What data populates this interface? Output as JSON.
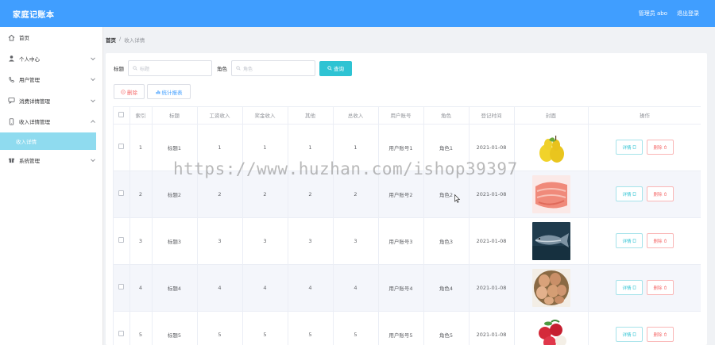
{
  "header": {
    "app_title": "家庭记账本",
    "admin_label": "管理员 abo",
    "logout_label": "退出登录"
  },
  "sidebar": {
    "items": [
      {
        "label": "首页",
        "icon": "home-icon"
      },
      {
        "label": "个人中心",
        "icon": "user-icon"
      },
      {
        "label": "用户管理",
        "icon": "phone-icon"
      },
      {
        "label": "消费详情管理",
        "icon": "chat-icon"
      },
      {
        "label": "收入详情管理",
        "icon": "mobile-icon"
      },
      {
        "label": "系统管理",
        "icon": "gift-icon"
      }
    ],
    "sub_item": {
      "label": "收入详情"
    }
  },
  "breadcrumb": {
    "home": "首页",
    "separator": "/",
    "current": "收入详情"
  },
  "search": {
    "title_label": "标题",
    "title_placeholder": "标题",
    "role_label": "角色",
    "role_placeholder": "角色",
    "query_label": "查询"
  },
  "actions": {
    "delete_label": "删除",
    "stats_label": "统计报表"
  },
  "table": {
    "headers": [
      "索引",
      "标题",
      "工资收入",
      "奖金收入",
      "其他",
      "总收入",
      "用户账号",
      "角色",
      "登记时间",
      "封面",
      "操作"
    ],
    "rows": [
      {
        "index": "1",
        "title": "标题1",
        "salary": "1",
        "bonus": "1",
        "other": "1",
        "total": "1",
        "account": "用户账号1",
        "role": "角色1",
        "date": "2021-01-08",
        "cover": "pear"
      },
      {
        "index": "2",
        "title": "标题2",
        "salary": "2",
        "bonus": "2",
        "other": "2",
        "total": "2",
        "account": "用户账号2",
        "role": "角色2",
        "date": "2021-01-08",
        "cover": "meat"
      },
      {
        "index": "3",
        "title": "标题3",
        "salary": "3",
        "bonus": "3",
        "other": "3",
        "total": "3",
        "account": "用户账号3",
        "role": "角色3",
        "date": "2021-01-08",
        "cover": "fish"
      },
      {
        "index": "4",
        "title": "标题4",
        "salary": "4",
        "bonus": "4",
        "other": "4",
        "total": "4",
        "account": "用户账号4",
        "role": "角色4",
        "date": "2021-01-08",
        "cover": "eggs"
      },
      {
        "index": "5",
        "title": "标题5",
        "salary": "5",
        "bonus": "5",
        "other": "5",
        "total": "5",
        "account": "用户账号5",
        "role": "角色5",
        "date": "2021-01-08",
        "cover": "lychee"
      }
    ],
    "op_detail": "详情",
    "op_delete": "删除"
  },
  "watermark": "https://www.huzhan.com/ishop39397",
  "colors": {
    "primary": "#409eff",
    "accent": "#2ec3d3",
    "danger": "#f56c6c",
    "sidebar_active": "#8fdbef"
  }
}
